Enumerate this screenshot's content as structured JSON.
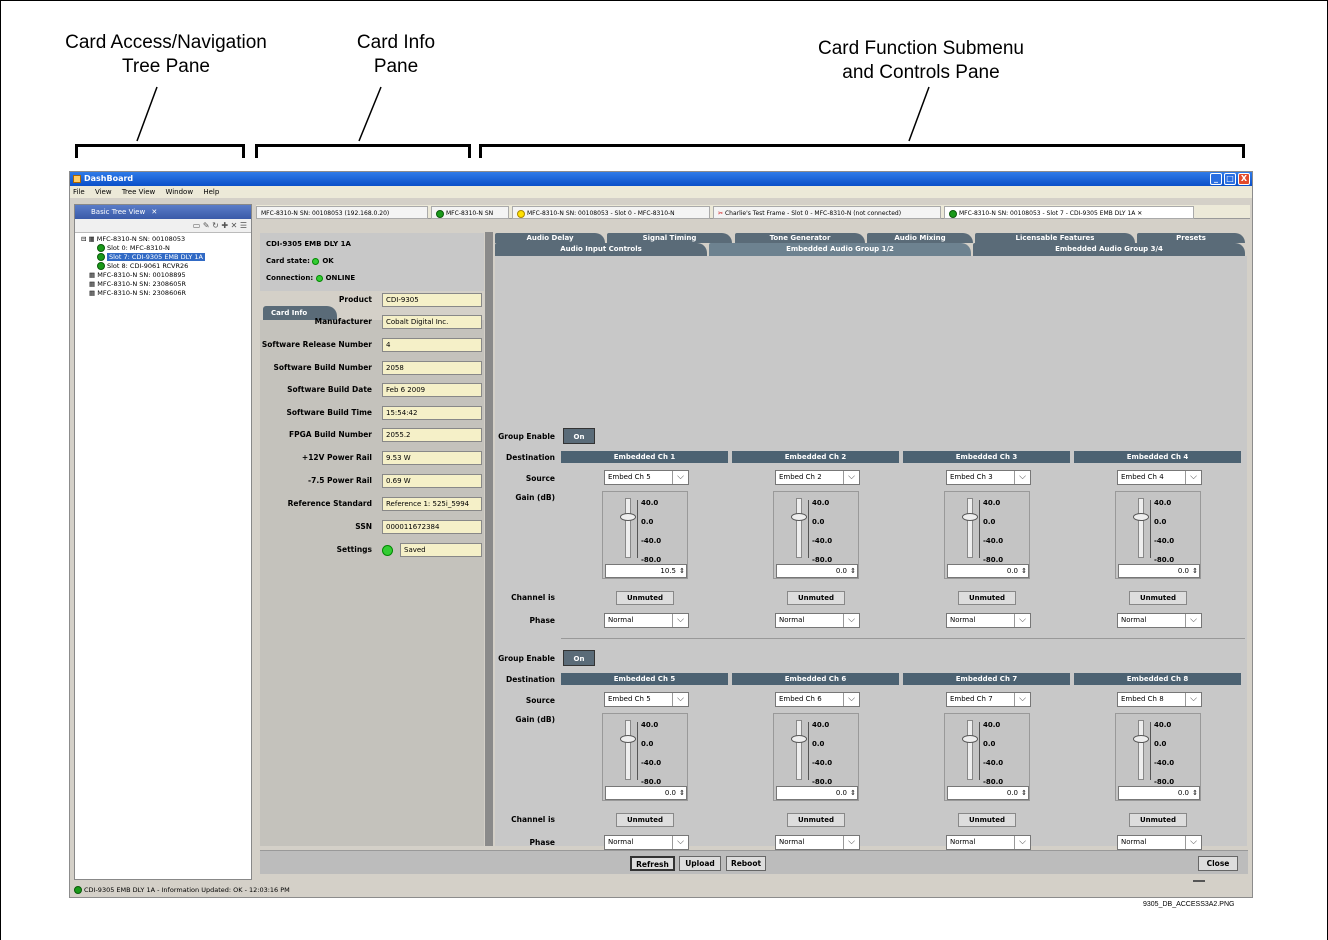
{
  "annotations": {
    "nav_line1": "Card Access/Navigation",
    "nav_line2": "Tree Pane",
    "info_line1": "Card Info",
    "info_line2": "Pane",
    "func_line1": "Card Function Submenu",
    "func_line2": "and Controls Pane"
  },
  "window": {
    "title": "DashBoard",
    "minimize": "_",
    "maximize": "□",
    "close": "X"
  },
  "menu": [
    "File",
    "View",
    "Tree View",
    "Window",
    "Help"
  ],
  "tree": {
    "title": "Basic Tree View",
    "close": "✕",
    "items": [
      "MFC-8310-N SN: 00108053",
      "Slot 0: MFC-8310-N",
      "Slot 7: CDI-9305 EMB DLY 1A",
      "Slot 8: CDI-9061 RCVR26",
      "MFC-8310-N SN: 00108895",
      "MFC-8310-N SN: 2308605R",
      "MFC-8310-N SN: 2308606R"
    ]
  },
  "status_text": "CDI-9305 EMB DLY 1A - Information Updated: OK - 12:03:16 PM",
  "tabs": [
    "MFC-8310-N SN: 00108053 (192.168.0.20)",
    "MFC-8310-N SN",
    "MFC-8310-N SN: 00108053 - Slot 0 - MFC-8310-N",
    "Charlie's Test Frame - Slot 0 - MFC-8310-N (not connected)",
    "MFC-8310-N SN: 00108053 - Slot 7 - CDI-9305 EMB DLY 1A"
  ],
  "card_header": {
    "name": "CDI-9305 EMB DLY 1A",
    "state_label": "Card state:",
    "state_value": "OK",
    "conn_label": "Connection:",
    "conn_value": "ONLINE"
  },
  "card_info_tab": "Card Info",
  "card_info": [
    {
      "label": "Product",
      "value": "CDI-9305"
    },
    {
      "label": "Manufacturer",
      "value": "Cobalt Digital Inc."
    },
    {
      "label": "Software Release Number",
      "value": "4"
    },
    {
      "label": "Software Build Number",
      "value": "2058"
    },
    {
      "label": "Software Build Date",
      "value": "Feb  6 2009"
    },
    {
      "label": "Software Build Time",
      "value": "15:54:42"
    },
    {
      "label": "FPGA Build Number",
      "value": "2055.2"
    },
    {
      "label": "+12V Power Rail",
      "value": "9.53 W"
    },
    {
      "label": "-7.5 Power Rail",
      "value": "0.69 W"
    },
    {
      "label": "Reference Standard",
      "value": "Reference 1: 525i_5994"
    },
    {
      "label": "SSN",
      "value": "000011672384"
    },
    {
      "label": "Settings",
      "value": "Saved"
    }
  ],
  "func_tabs_row1": [
    "Audio Delay",
    "Signal Timing",
    "Tone Generator",
    "Audio Mixing",
    "Licensable Features",
    "Presets"
  ],
  "func_tabs_row2": [
    "Audio Input Controls",
    "Embedded Audio Group 1/2",
    "Embedded Audio Group 3/4"
  ],
  "labels": {
    "group_enable": "Group Enable",
    "destination": "Destination",
    "source": "Source",
    "gain": "Gain (dB)",
    "channel_is": "Channel is",
    "phase": "Phase"
  },
  "group1": {
    "enable": "On",
    "channels": [
      {
        "dest": "Embedded Ch 1",
        "source": "Embed Ch 5",
        "gain": "10.5",
        "state": "Unmuted",
        "phase": "Normal"
      },
      {
        "dest": "Embedded Ch 2",
        "source": "Embed Ch 2",
        "gain": "0.0",
        "state": "Unmuted",
        "phase": "Normal"
      },
      {
        "dest": "Embedded Ch 3",
        "source": "Embed Ch 3",
        "gain": "0.0",
        "state": "Unmuted",
        "phase": "Normal"
      },
      {
        "dest": "Embedded Ch 4",
        "source": "Embed Ch 4",
        "gain": "0.0",
        "state": "Unmuted",
        "phase": "Normal"
      }
    ]
  },
  "group2": {
    "enable": "On",
    "channels": [
      {
        "dest": "Embedded Ch 5",
        "source": "Embed Ch 5",
        "gain": "0.0",
        "state": "Unmuted",
        "phase": "Normal"
      },
      {
        "dest": "Embedded Ch 6",
        "source": "Embed Ch 6",
        "gain": "0.0",
        "state": "Unmuted",
        "phase": "Normal"
      },
      {
        "dest": "Embedded Ch 7",
        "source": "Embed Ch 7",
        "gain": "0.0",
        "state": "Unmuted",
        "phase": "Normal"
      },
      {
        "dest": "Embedded Ch 8",
        "source": "Embed Ch 8",
        "gain": "0.0",
        "state": "Unmuted",
        "phase": "Normal"
      }
    ]
  },
  "gain_scale": [
    "40.0",
    "0.0",
    "-40.0",
    "-80.0"
  ],
  "footer": {
    "refresh": "Refresh",
    "upload": "Upload",
    "reboot": "Reboot",
    "close": "Close"
  },
  "filename": "9305_DB_ACCESS3A2.PNG",
  "colors": {
    "accent": "#5a6b78",
    "titlebar": "#0a4fc8",
    "ok": "#33cc33"
  }
}
